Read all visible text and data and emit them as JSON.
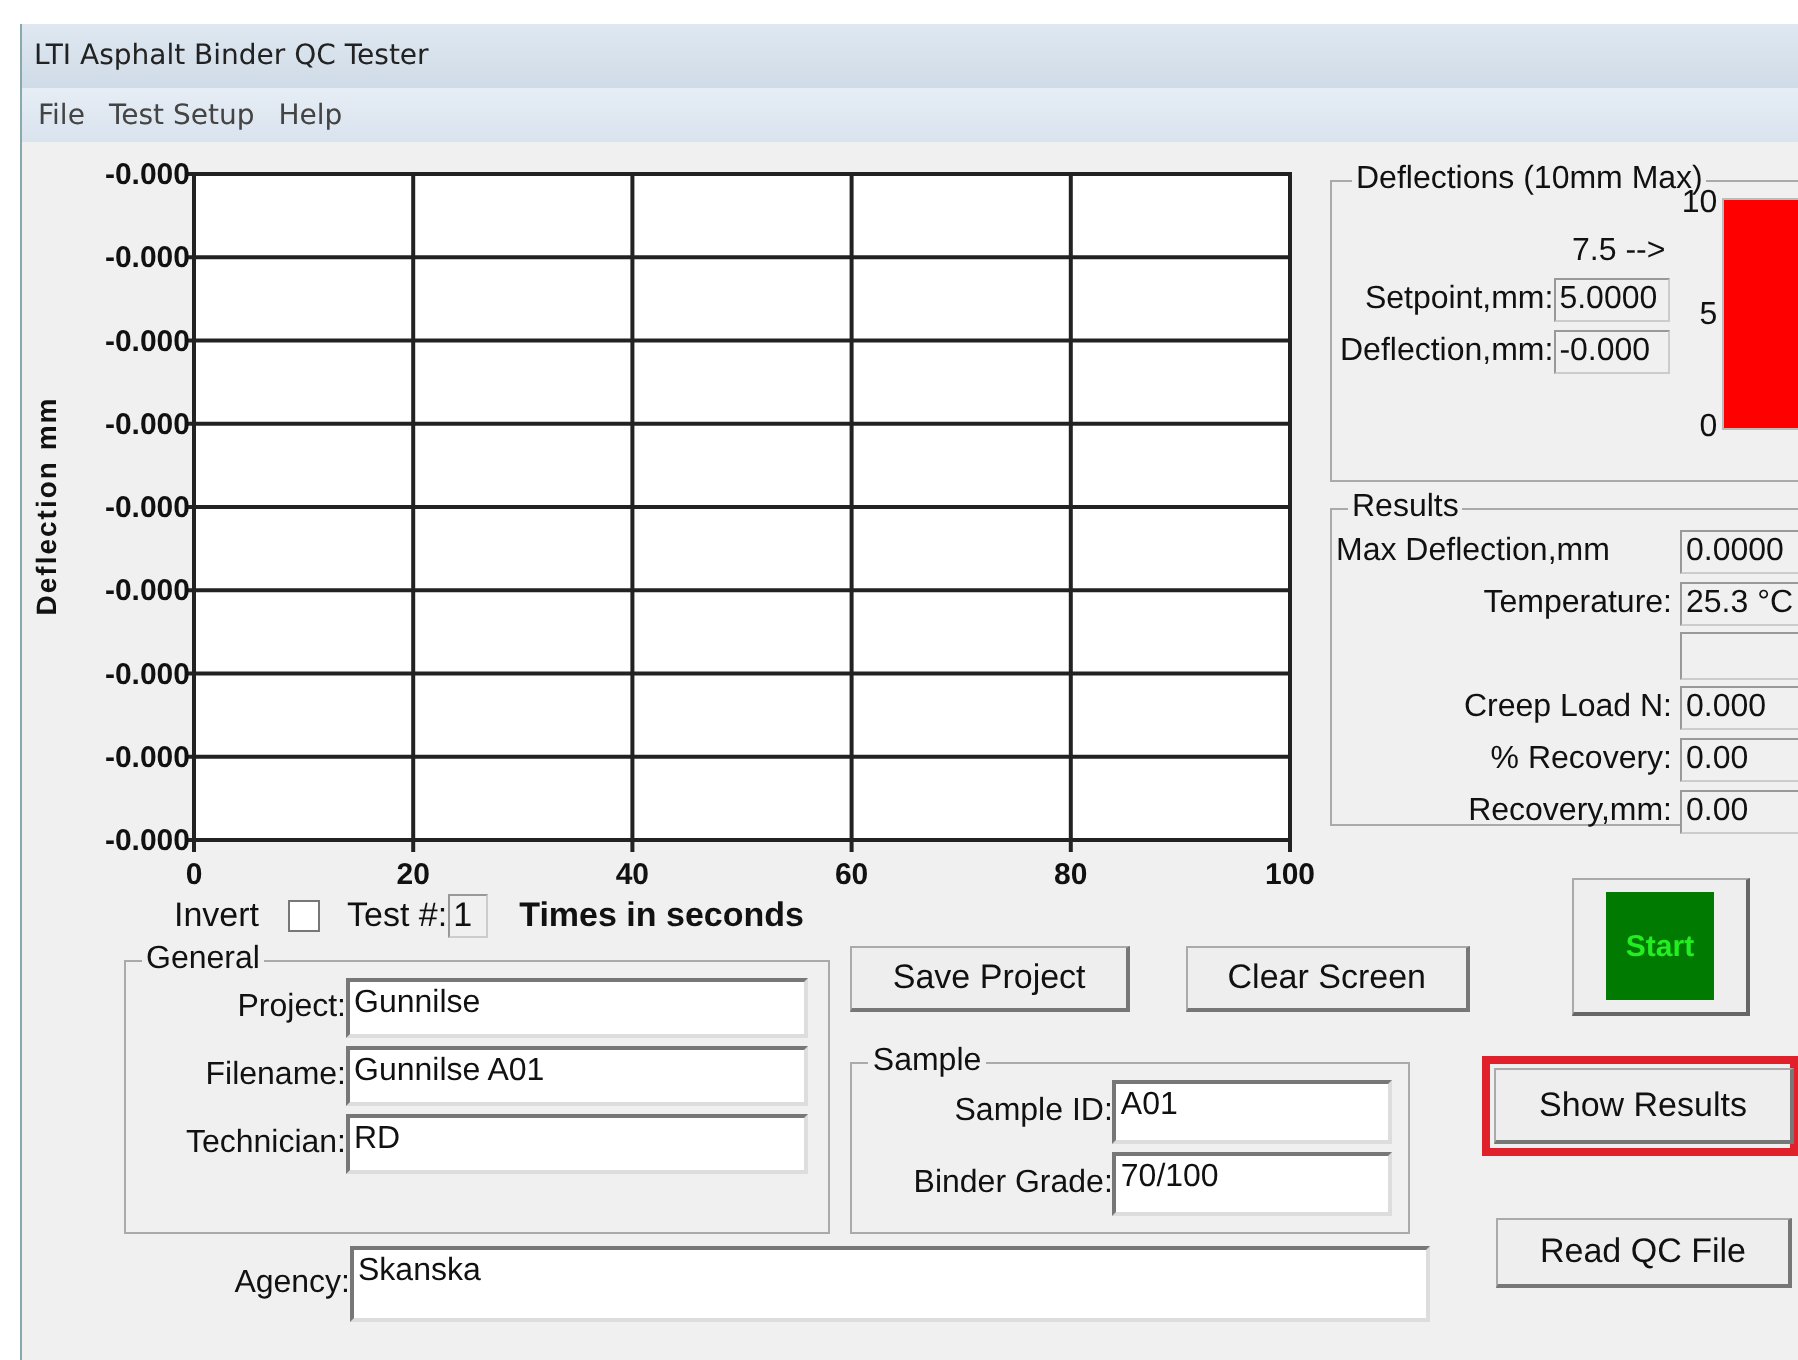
{
  "window": {
    "title": "LTI Asphalt Binder QC Tester"
  },
  "menu": [
    "File",
    "Test Setup",
    "Help"
  ],
  "plot": {
    "y_title": "Deflection mm",
    "x_title": "Times in seconds",
    "x_labels": [
      "0",
      "20",
      "40",
      "60",
      "80",
      "100"
    ],
    "y_labels": [
      "-0.000",
      "-0.000",
      "-0.000",
      "-0.000",
      "-0.000",
      "-0.000",
      "-0.000",
      "-0.000",
      "-0.000"
    ]
  },
  "invert": {
    "label": "Invert",
    "checked": false
  },
  "test_number": {
    "label": "Test #:",
    "value": "1"
  },
  "deflections": {
    "title": "Deflections (10mm Max)",
    "scale": [
      "10",
      "5",
      "0"
    ],
    "marker": "7.5 -->",
    "setpoint": {
      "label": "Setpoint,mm:",
      "value": "5.0000"
    },
    "deflection": {
      "label": "Deflection,mm:",
      "value": "-0.000"
    },
    "level": 1
  },
  "results": {
    "title": "Results",
    "rows": [
      {
        "kind": "field",
        "label": "Max Deflection,mm",
        "value": "0.0000"
      },
      {
        "kind": "field",
        "label": "Temperature:",
        "value": "25.3 °C"
      },
      {
        "kind": "blank"
      },
      {
        "kind": "field",
        "label": "Creep Load N:",
        "value": "0.000"
      },
      {
        "kind": "field",
        "label": "% Recovery:",
        "value": "0.00"
      },
      {
        "kind": "field",
        "label": "Recovery,mm:",
        "value": "0.00"
      }
    ]
  },
  "buttons": {
    "save": "Save Project",
    "clear": "Clear Screen",
    "start": "Start",
    "show_results": {
      "label": "Show Results",
      "highlighted": true
    },
    "read": "Read QC File"
  },
  "general": {
    "title": "General",
    "fields": [
      {
        "label": "Project:",
        "value": "Gunnilse"
      },
      {
        "label": "Filename:",
        "value": "Gunnilse A01"
      },
      {
        "label": "Technician:",
        "value": "RD"
      }
    ]
  },
  "sample": {
    "title": "Sample",
    "fields": [
      {
        "label": "Sample ID:",
        "value": "A01"
      },
      {
        "label": "Binder Grade:",
        "value": "70/100"
      }
    ]
  },
  "agency": {
    "label": "Agency:",
    "value": "Skanska"
  }
}
